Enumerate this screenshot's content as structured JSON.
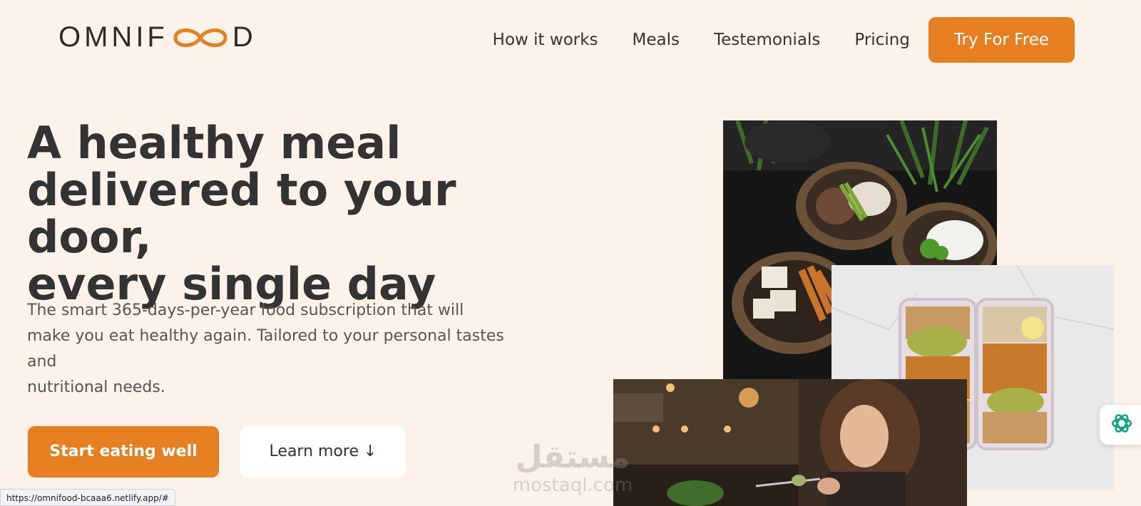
{
  "header": {
    "logo": {
      "left": "OMNIF",
      "right": "D"
    },
    "nav": [
      {
        "label": "How it works"
      },
      {
        "label": "Meals"
      },
      {
        "label": "Testemonials"
      },
      {
        "label": "Pricing"
      }
    ],
    "cta_label": "Try For Free"
  },
  "hero": {
    "title_lines": [
      "A healthy meal",
      "delivered to your door,",
      "every single day"
    ],
    "description_lines": [
      "The smart 365-days-per-year food subscription that will",
      "make you eat healthy again. Tailored to your personal tastes and",
      "nutritional needs."
    ],
    "primary_button": "Start eating well",
    "secondary_button": "Learn more ↓"
  },
  "watermark": {
    "arabic": "مستقل",
    "latin": "mostaql.com"
  },
  "status_bar": {
    "url": "https://omnifood-bcaaa6.netlify.app/#"
  },
  "colors": {
    "accent": "#e67e22",
    "background": "#fdf2e9",
    "text": "#333333"
  },
  "icons": {
    "widget": "chatgpt-icon",
    "logo_mark": "infinity-icon"
  }
}
